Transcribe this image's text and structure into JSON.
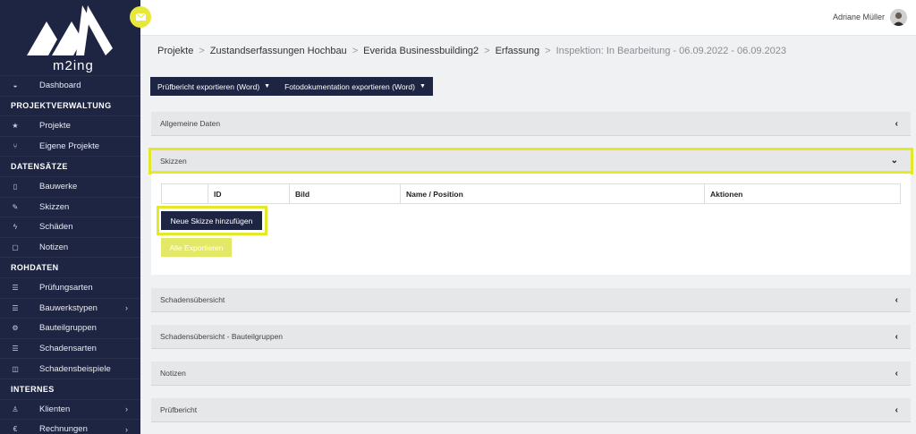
{
  "brand": {
    "logo_text": "m2ing",
    "accent_color": "#e3e82b",
    "sidebar_color": "#1e2542"
  },
  "sidebar": {
    "dashboard": {
      "label": "Dashboard",
      "icon": "dashboard-icon"
    },
    "sections": [
      {
        "title": "PROJEKTVERWALTUNG",
        "items": [
          {
            "label": "Projekte",
            "icon": "star-icon"
          },
          {
            "label": "Eigene Projekte",
            "icon": "branch-icon"
          }
        ]
      },
      {
        "title": "DATENSÄTZE",
        "items": [
          {
            "label": "Bauwerke",
            "icon": "building-icon"
          },
          {
            "label": "Skizzen",
            "icon": "edit-icon"
          },
          {
            "label": "Schäden",
            "icon": "bolt-icon"
          },
          {
            "label": "Notizen",
            "icon": "file-icon"
          }
        ]
      },
      {
        "title": "ROHDATEN",
        "items": [
          {
            "label": "Prüfungsarten",
            "icon": "list-icon"
          },
          {
            "label": "Bauwerkstypen",
            "icon": "list-icon",
            "chevron": "›"
          },
          {
            "label": "Bauteilgruppen",
            "icon": "cogs-icon"
          },
          {
            "label": "Schadensarten",
            "icon": "list-icon"
          },
          {
            "label": "Schadensbeispiele",
            "icon": "columns-icon"
          }
        ]
      },
      {
        "title": "INTERNES",
        "items": [
          {
            "label": "Klienten",
            "icon": "person-icon",
            "chevron": "›"
          },
          {
            "label": "Rechnungen",
            "icon": "euro-icon",
            "chevron": "›"
          }
        ]
      }
    ]
  },
  "topbar": {
    "user_name": "Adriane Müller"
  },
  "breadcrumb": {
    "items": [
      "Projekte",
      "Zustandserfassungen Hochbau",
      "Everida Businessbuilding2",
      "Erfassung"
    ],
    "current": "Inspektion: In Bearbeitung - 06.09.2022 - 06.09.2023",
    "separator": ">"
  },
  "export": {
    "word_report": "Prüfbericht exportieren (Word)",
    "photo_doc": "Fotodokumentation exportieren (Word)"
  },
  "panels": {
    "allgemeine": "Allgemeine Daten",
    "skizzen": "Skizzen",
    "schadensuebersicht": "Schadensübersicht",
    "schadensuebersicht_bg": "Schadensübersicht - Bauteilgruppen",
    "notizen": "Notizen",
    "pruefbericht": "Prüfbericht"
  },
  "skizzen_table": {
    "columns": [
      "",
      "ID",
      "Bild",
      "Name / Position",
      "Aktionen"
    ]
  },
  "buttons": {
    "add_sketch": "Neue Skizze hinzufügen",
    "export_all": "Alle Exportieren"
  }
}
